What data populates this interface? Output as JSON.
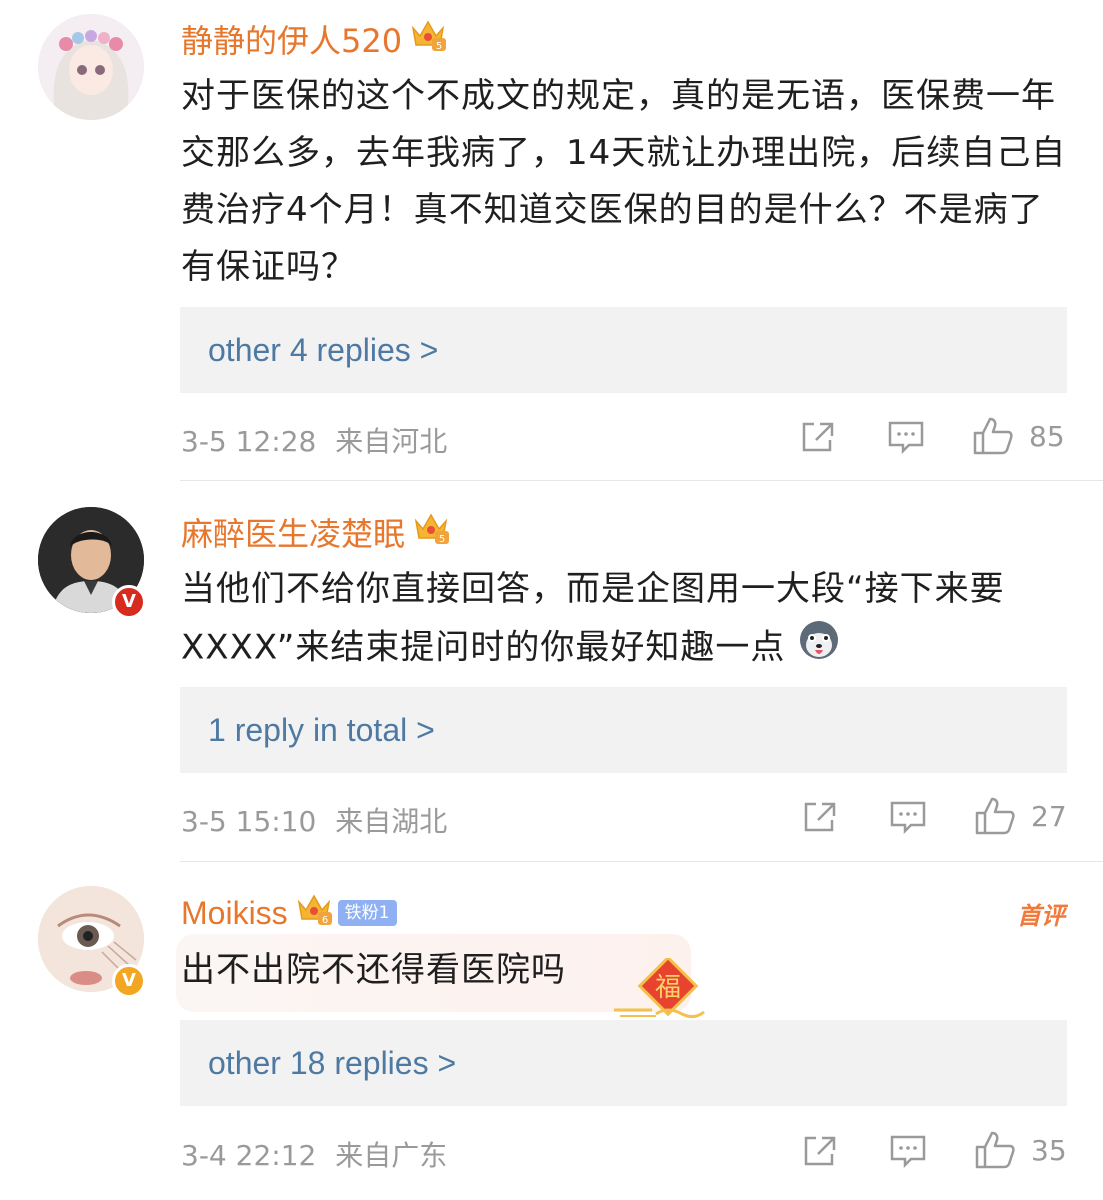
{
  "comments": [
    {
      "username": "静静的伊人520",
      "text": "对于医保的这个不成文的规定，真的是无语，医保费一年交那么多，去年我病了，14天就让办理出院，后续自己自费治疗4个月！真不知道交医保的目的是什么？不是病了有保证吗？",
      "replies_label": "other 4 replies >",
      "time": "3-5 12:28",
      "location": "来自河北",
      "likes": "85",
      "crown_icon": "crown-icon"
    },
    {
      "username": "麻醉医生凌楚眠",
      "text": "当他们不给你直接回答，而是企图用一大段“接下来要XXXX”来结束提问时的你最好知趣一点",
      "replies_label": "1 reply in total >",
      "time": "3-5 15:10",
      "location": "来自湖北",
      "likes": "27",
      "crown_icon": "crown-icon",
      "verified_color": "#d62b1e"
    },
    {
      "username": "Moikiss",
      "fan_badge": "铁粉1",
      "tag": "首评",
      "text": "出不出院不还得看医院吗",
      "replies_label": "other 18 replies >",
      "time": "3-4 22:12",
      "location": "来自广东",
      "likes": "35",
      "crown_icon": "crown-icon",
      "verified_color": "#f2a623"
    }
  ],
  "colors": {
    "username": "#e8772e",
    "link": "#4e79a3",
    "meta": "#9a9a9a",
    "reply_bg": "#f2f2f2"
  }
}
